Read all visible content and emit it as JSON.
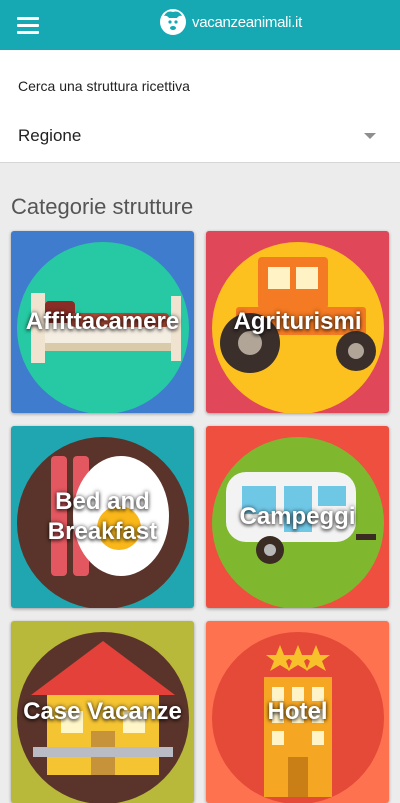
{
  "header": {
    "logo_text": "vacanzeanimali.it",
    "menu_icon": "hamburger-menu-icon",
    "logo_icon": "dog-head-icon",
    "background_color": "#16a8b3"
  },
  "search": {
    "label": "Cerca una struttura ricettiva",
    "region_value": "Regione",
    "dropdown_icon": "caret-down-icon"
  },
  "categories": {
    "title": "Categorie strutture",
    "items": [
      {
        "label": "Affittacamere",
        "icon": "bed-icon",
        "bg": "#3f7ccd"
      },
      {
        "label": "Agriturismi",
        "icon": "tractor-icon",
        "bg": "#e04759"
      },
      {
        "label": "Bed and Breakfast",
        "icon": "bacon-egg-icon",
        "bg": "#20a6b0"
      },
      {
        "label": "Campeggi",
        "icon": "camper-trailer-icon",
        "bg": "#ee4f3f"
      },
      {
        "label": "Case Vacanze",
        "icon": "house-icon",
        "bg": "#b8b83b"
      },
      {
        "label": "Hotel",
        "icon": "hotel-building-icon",
        "bg": "#ff7250"
      }
    ]
  }
}
